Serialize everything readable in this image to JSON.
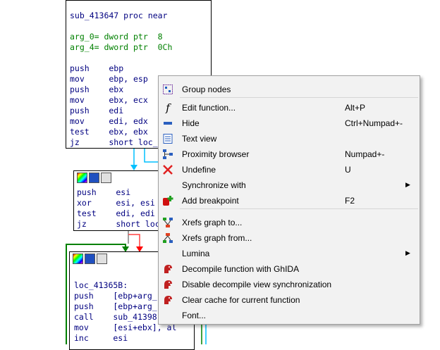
{
  "node1": {
    "lines": [
      {
        "text": "sub_413647 proc near",
        "style": "blue"
      },
      {
        "text": "",
        "style": "blue"
      },
      {
        "text": "arg_0= dword ptr  8",
        "style": "green"
      },
      {
        "text": "arg_4= dword ptr  0Ch",
        "style": "green"
      },
      {
        "text": "",
        "style": "blue"
      },
      {
        "text": "push    ebp",
        "style": "blue"
      },
      {
        "text": "mov     ebp, esp",
        "style": "blue"
      },
      {
        "text": "push    ebx",
        "style": "blue"
      },
      {
        "text": "mov     ebx, ecx",
        "style": "blue"
      },
      {
        "text": "push    edi",
        "style": "blue"
      },
      {
        "text": "mov     edi, edx",
        "style": "blue"
      },
      {
        "text": "test    ebx, ebx",
        "style": "blue"
      },
      {
        "text": "jz      short loc_",
        "style": "blue"
      }
    ]
  },
  "node2": {
    "lines": [
      {
        "text": "push    esi"
      },
      {
        "text": "xor     esi, esi"
      },
      {
        "text": "test    edi, edi"
      },
      {
        "text": "jz      short loc"
      }
    ]
  },
  "node3": {
    "lines": [
      {
        "text": ""
      },
      {
        "text": "loc_41365B:"
      },
      {
        "text": "push    [ebp+arg_"
      },
      {
        "text": "push    [ebp+arg_"
      },
      {
        "text": "call    sub_41398"
      },
      {
        "text": "mov     [esi+ebx], al"
      },
      {
        "text": "inc     esi"
      }
    ]
  },
  "menu": {
    "items": [
      {
        "label": "Group nodes",
        "shortcut": "",
        "icon": "group-nodes-icon",
        "submenu": false
      },
      {
        "label": "Edit function...",
        "shortcut": "Alt+P",
        "icon": "function-icon",
        "submenu": false
      },
      {
        "label": "Hide",
        "shortcut": "Ctrl+Numpad+-",
        "icon": "hide-icon",
        "submenu": false
      },
      {
        "label": "Text view",
        "shortcut": "",
        "icon": "text-view-icon",
        "submenu": false
      },
      {
        "label": "Proximity browser",
        "shortcut": "Numpad+-",
        "icon": "proximity-icon",
        "submenu": false
      },
      {
        "label": "Undefine",
        "shortcut": "U",
        "icon": "undefine-icon",
        "submenu": false
      },
      {
        "label": "Synchronize with",
        "shortcut": "",
        "icon": "",
        "submenu": true
      },
      {
        "label": "Add breakpoint",
        "shortcut": "F2",
        "icon": "breakpoint-icon",
        "submenu": false
      },
      {
        "label": "Xrefs graph to...",
        "shortcut": "",
        "icon": "xrefs-to-icon",
        "submenu": false
      },
      {
        "label": "Xrefs graph from...",
        "shortcut": "",
        "icon": "xrefs-from-icon",
        "submenu": false
      },
      {
        "label": "Lumina",
        "shortcut": "",
        "icon": "",
        "submenu": true
      },
      {
        "label": "Decompile function with GhIDA",
        "shortcut": "",
        "icon": "ghida-icon",
        "submenu": false
      },
      {
        "label": "Disable decompile view synchronization",
        "shortcut": "",
        "icon": "ghida-icon",
        "submenu": false
      },
      {
        "label": "Clear cache for current function",
        "shortcut": "",
        "icon": "ghida-icon",
        "submenu": false
      },
      {
        "label": "Font...",
        "shortcut": "",
        "icon": "",
        "submenu": false
      }
    ]
  },
  "colors": {
    "code_blue": "#000080",
    "code_green": "#008000",
    "edge_green": "#008000",
    "edge_red": "#ff0000",
    "edge_cyan": "#00c0ff",
    "edge_gray": "#808080"
  }
}
